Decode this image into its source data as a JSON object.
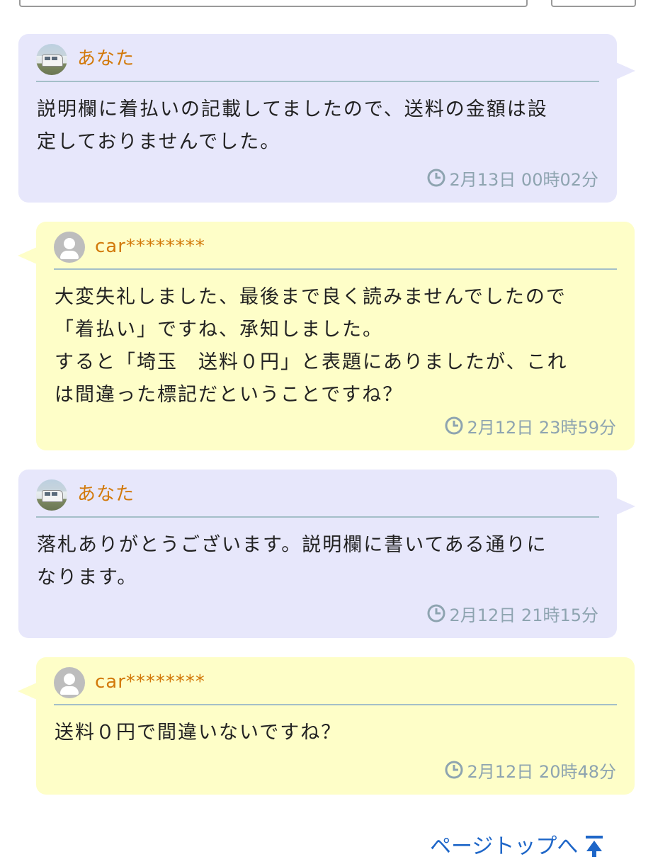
{
  "messages": [
    {
      "author": "あなた",
      "text": "説明欄に着払いの記載してましたので、送料の金額は設\n定しておりませんでした。",
      "time": "2月13日 00時02分"
    },
    {
      "author": "car********",
      "text": "大変失礼しました、最後まで良く読みませんでしたので\n「着払い」ですね、承知しました。\nすると「埼玉　送料０円」と表題にありましたが、これ\nは間違った標記だということですね？",
      "time": "2月12日 23時59分"
    },
    {
      "author": "あなた",
      "text": "落札ありがとうございます。説明欄に書いてある通りに\nなります。",
      "time": "2月12日 21時15分"
    },
    {
      "author": "car********",
      "text": "送料０円で間違いないですね？",
      "time": "2月12日 20時48分"
    }
  ],
  "footer": {
    "page_top_label": "ページトップへ"
  },
  "colors": {
    "mine_bubble": "#e7e7fb",
    "their_bubble": "#fefec8",
    "author_name": "#d2790a",
    "timestamp": "#8ea4b0",
    "link": "#1e66c8"
  }
}
